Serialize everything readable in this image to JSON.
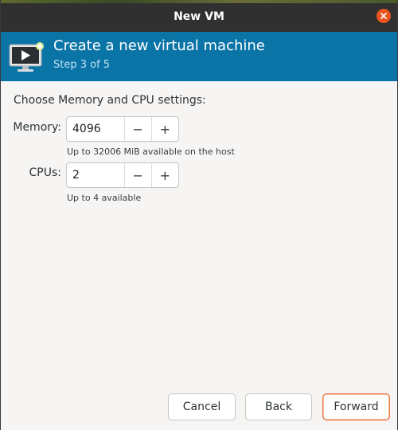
{
  "window": {
    "title": "New VM"
  },
  "header": {
    "heading": "Create a new virtual machine",
    "step": "Step 3 of 5",
    "background": "#0b74a6"
  },
  "body": {
    "section_label": "Choose Memory and CPU settings:",
    "memory": {
      "label": "Memory:",
      "value": "4096",
      "hint": "Up to 32006 MiB available on the host"
    },
    "cpus": {
      "label": "CPUs:",
      "value": "2",
      "hint": "Up to 4 available"
    },
    "decrement_symbol": "−",
    "increment_symbol": "+"
  },
  "footer": {
    "cancel_label": "Cancel",
    "back_label": "Back",
    "forward_label": "Forward"
  },
  "colors": {
    "accent": "#e95420",
    "titlebar": "#303030"
  },
  "icons": {
    "close": "close-icon",
    "vm": "virtual-machine-monitor-icon"
  }
}
